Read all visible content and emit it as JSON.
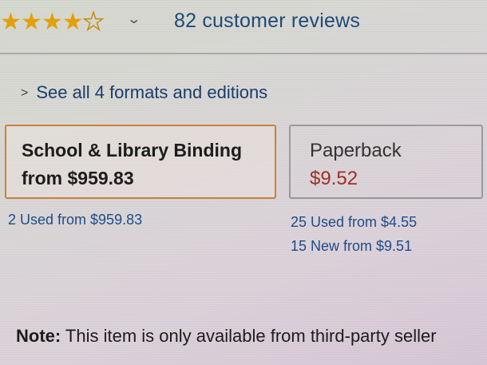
{
  "rating": {
    "stars_filled": 4,
    "stars_total": 5,
    "review_count_text": "82 customer reviews"
  },
  "formats": {
    "see_all_text": "See all 4 formats and editions",
    "options": [
      {
        "name": "School & Library Binding",
        "price": "from $959.83",
        "selected": true
      },
      {
        "name": "Paperback",
        "price": "$9.52",
        "selected": false
      }
    ]
  },
  "offers": {
    "binding_used": "2 Used from $959.83",
    "paperback_used": "25 Used from $4.55",
    "paperback_new": "15 New from $9.51"
  },
  "note": {
    "label": "Note:",
    "text": " This item is only available from third-party seller"
  },
  "colors": {
    "star": "#e3a00a",
    "link": "#1f4d86",
    "price": "#9c2f26",
    "selected_border": "#c8813a"
  },
  "icons": [
    "star-icon",
    "chevron-down-icon",
    "chevron-right-icon"
  ]
}
